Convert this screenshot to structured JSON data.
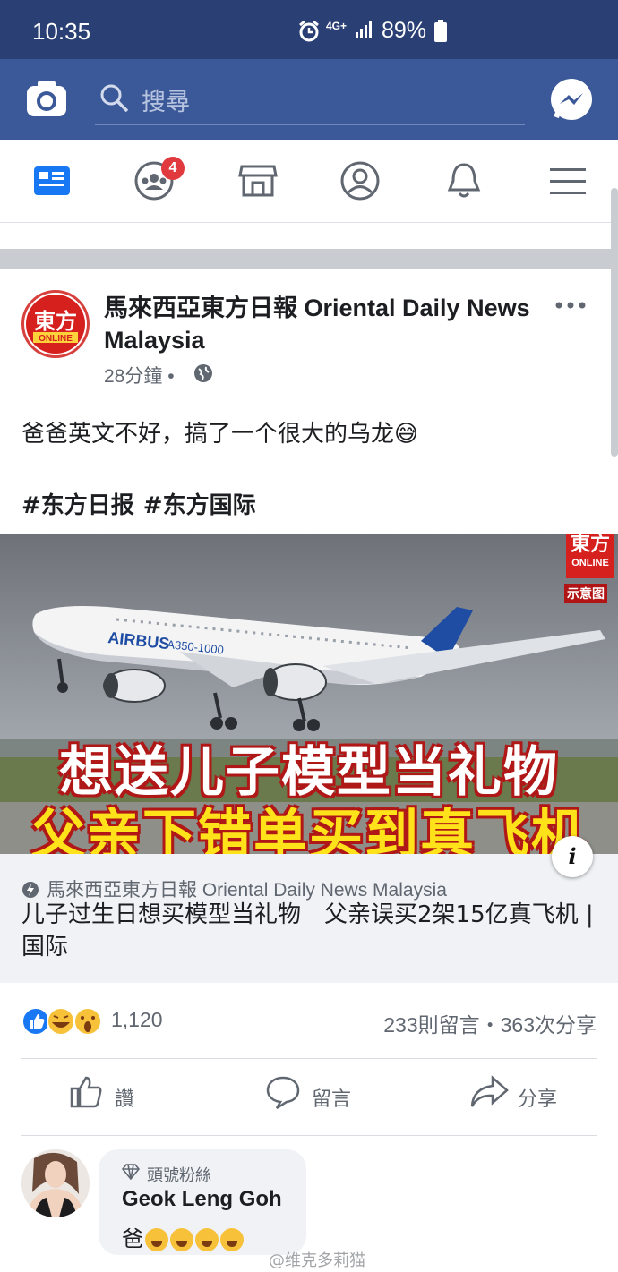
{
  "status_bar": {
    "time": "10:35",
    "network": "4G+",
    "battery": "89%"
  },
  "header": {
    "search_placeholder": "搜尋"
  },
  "nav": {
    "groups_badge": "4"
  },
  "post": {
    "page_name": "馬來西亞東方日報 Oriental Daily News Malaysia",
    "time": "28分鐘",
    "time_separator": "•",
    "text": "爸爸英文不好，搞了一个很大的乌龙😅",
    "hashtags": [
      "#东方日报",
      "#东方国际"
    ],
    "image": {
      "headline_line1": "想送儿子模型当礼物",
      "headline_line2": "父亲下错单买到真飞机",
      "logo_cn": "東方",
      "logo_en": "ONLINE",
      "illustration_label": "示意图"
    },
    "link": {
      "source": "馬來西亞東方日報 Oriental Daily News Malaysia",
      "title": "儿子过生日想买模型当礼物　父亲误买2架15亿真飞机 | 国际"
    },
    "reactions_count": "1,120",
    "comments_shares": "233則留言・363次分享",
    "actions": {
      "like": "讚",
      "comment": "留言",
      "share": "分享"
    }
  },
  "comment": {
    "badge": "頭號粉絲",
    "author": "Geok Leng Goh",
    "text": "爸"
  },
  "watermark": "@维克多莉猫",
  "colors": {
    "status_bar": "#2a3f73",
    "header": "#3b5998",
    "link_box": "#f0f2f5",
    "like_blue": "#1877f2"
  }
}
